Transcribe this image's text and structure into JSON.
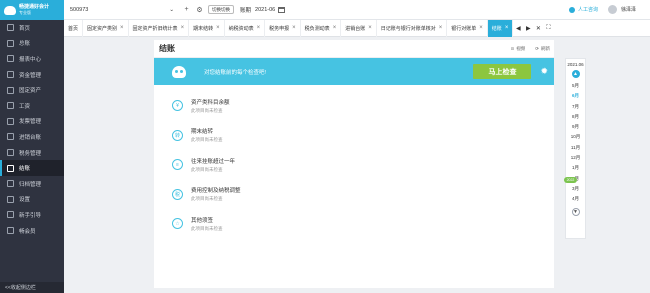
{
  "app": {
    "logo_line1": "畅捷通好会计",
    "logo_line2": "专业版"
  },
  "sidebar": {
    "items": [
      {
        "label": "首页",
        "icon": "home-icon"
      },
      {
        "label": "总账",
        "icon": "ledger-icon"
      },
      {
        "label": "报表中心",
        "icon": "report-icon"
      },
      {
        "label": "资金管理",
        "icon": "fund-icon"
      },
      {
        "label": "固定资产",
        "icon": "asset-icon"
      },
      {
        "label": "工资",
        "icon": "salary-icon"
      },
      {
        "label": "发票管理",
        "icon": "invoice-icon"
      },
      {
        "label": "进销台账",
        "icon": "stock-icon"
      },
      {
        "label": "税务管理",
        "icon": "tax-icon"
      },
      {
        "label": "结账",
        "icon": "closing-icon",
        "active": true
      },
      {
        "label": "归档管理",
        "icon": "archive-icon"
      },
      {
        "label": "设置",
        "icon": "settings-icon"
      },
      {
        "label": "新手引导",
        "icon": "guide-icon"
      },
      {
        "label": "畅会员",
        "icon": "member-icon"
      }
    ],
    "footer": "<<收起侧边栏"
  },
  "topbar": {
    "company": "500973",
    "switch_label": "切换切换",
    "period_label": "账期",
    "period_value": "2021-06",
    "service_label": "人工咨询",
    "user_label": "徐泽泽"
  },
  "tabs": [
    {
      "label": "首页",
      "closable": false
    },
    {
      "label": "固定资产类别",
      "closable": true
    },
    {
      "label": "固定资产折旧统计表",
      "closable": true
    },
    {
      "label": "期末结转",
      "closable": true
    },
    {
      "label": "纳税资动表",
      "closable": true
    },
    {
      "label": "税务申报",
      "closable": true
    },
    {
      "label": "税负测动表",
      "closable": true
    },
    {
      "label": "进销台账",
      "closable": true
    },
    {
      "label": "日记账与银行对账单核对",
      "closable": true
    },
    {
      "label": "银行对账单",
      "closable": true
    },
    {
      "label": "结账",
      "closable": true,
      "active": true
    }
  ],
  "main": {
    "title": "结账",
    "action_video": "视频",
    "action_refresh": "刷新",
    "banner_text": "对您结账前的每个检查吧!",
    "check_button": "马上检查",
    "items": [
      {
        "icon": "yuan-icon",
        "glyph": "¥",
        "title": "资产类科目余额",
        "sub": "此项目尚未检查"
      },
      {
        "icon": "transfer-icon",
        "glyph": "转",
        "title": "期末结转",
        "sub": "此项目尚未检查"
      },
      {
        "icon": "document-icon",
        "glyph": "≡",
        "title": "往来挂账超过一年",
        "sub": "此项目尚未检查"
      },
      {
        "icon": "tax-control-icon",
        "glyph": "税",
        "title": "费用控制及纳税调整",
        "sub": "此项目尚未检查"
      },
      {
        "icon": "star-icon",
        "glyph": "☆",
        "title": "其他须签",
        "sub": "此项目尚未检查"
      }
    ]
  },
  "month_panel": {
    "year": "2021.06",
    "months": [
      "5月",
      "6月",
      "7月",
      "8月",
      "9月",
      "10月",
      "11月",
      "12月",
      "1月",
      "2月",
      "3月",
      "4月"
    ],
    "current_index": 1,
    "year_badge": "2022"
  },
  "colors": {
    "accent": "#2aaeda",
    "banner": "#46c3e2",
    "button_green": "#8cc63f",
    "sidebar_bg": "#2f3340"
  }
}
